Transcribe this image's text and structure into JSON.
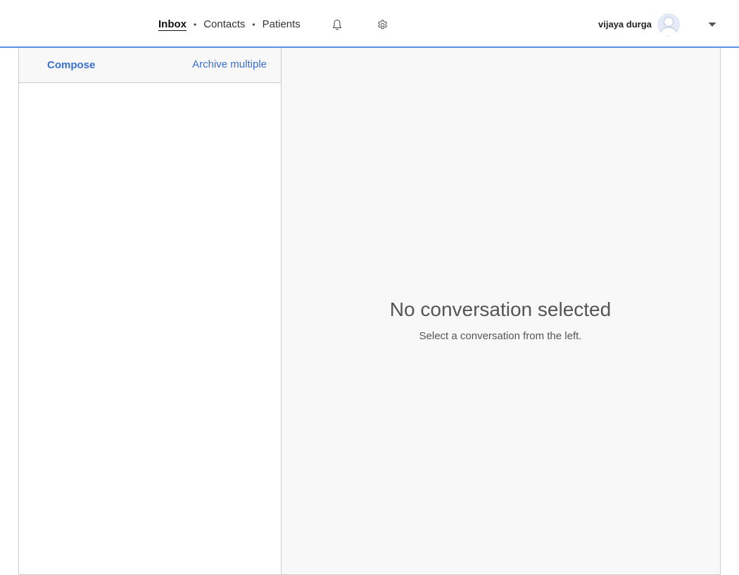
{
  "nav": {
    "items": [
      {
        "label": "Inbox",
        "active": true
      },
      {
        "label": "Contacts",
        "active": false
      },
      {
        "label": "Patients",
        "active": false
      }
    ],
    "separator": "•"
  },
  "header": {
    "icons": [
      "bell-icon",
      "gear-icon"
    ],
    "user_name": "vijaya durga",
    "accent_color": "#5b8ee6"
  },
  "sidebar": {
    "compose_label": "Compose",
    "archive_label": "Archive multiple",
    "link_color": "#3a6fcf"
  },
  "main": {
    "empty_title": "No conversation selected",
    "empty_subtitle": "Select a conversation from the left."
  }
}
